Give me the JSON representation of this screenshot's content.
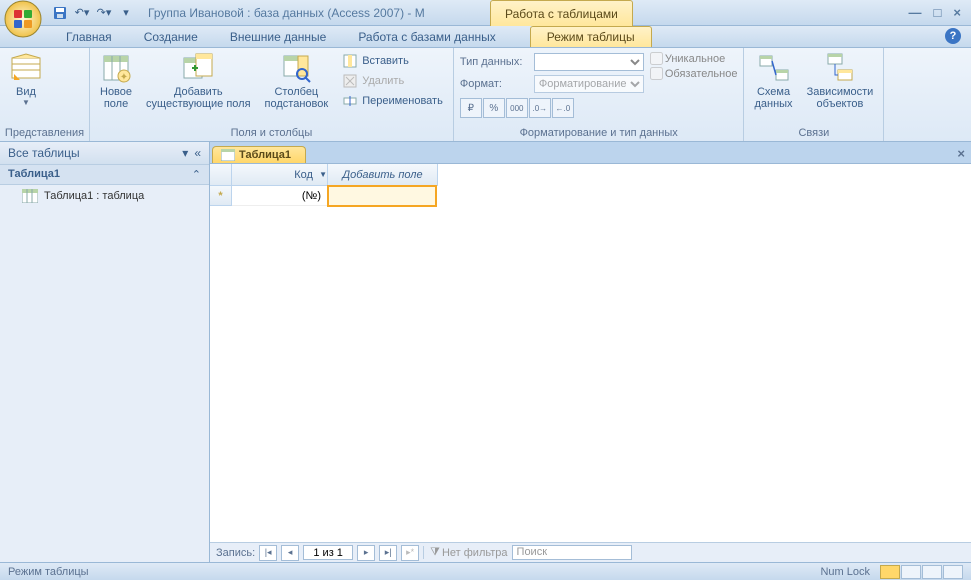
{
  "title": "Группа Ивановой : база данных (Access 2007) - M",
  "context_tab_title": "Работа с таблицами",
  "tabs": {
    "home": "Главная",
    "create": "Создание",
    "external": "Внешние данные",
    "dbtools": "Работа с базами данных",
    "datasheet": "Режим таблицы"
  },
  "ribbon": {
    "views": {
      "label": "Представления",
      "view_btn": "Вид"
    },
    "fields": {
      "label": "Поля и столбцы",
      "new_field": "Новое\nполе",
      "add_existing": "Добавить\nсуществующие поля",
      "lookup_col": "Столбец\nподстановок",
      "insert": "Вставить",
      "delete": "Удалить",
      "rename": "Переименовать"
    },
    "formatting": {
      "label": "Форматирование и тип данных",
      "data_type": "Тип данных:",
      "format": "Формат:",
      "format_ph": "Форматирование",
      "unique": "Уникальное",
      "required": "Обязательное"
    },
    "relationships": {
      "label": "Связи",
      "schema": "Схема\nданных",
      "deps": "Зависимости\nобъектов"
    }
  },
  "nav": {
    "title": "Все таблицы",
    "group": "Таблица1",
    "item": "Таблица1 : таблица"
  },
  "doc_tab": "Таблица1",
  "grid": {
    "col_id": "Код",
    "col_add": "Добавить поле",
    "row_marker": "*",
    "id_value": "(№)"
  },
  "recnav": {
    "label": "Запись:",
    "pos": "1 из 1",
    "no_filter": "Нет фильтра",
    "search": "Поиск"
  },
  "status": {
    "mode": "Режим таблицы",
    "numlock": "Num Lock"
  }
}
